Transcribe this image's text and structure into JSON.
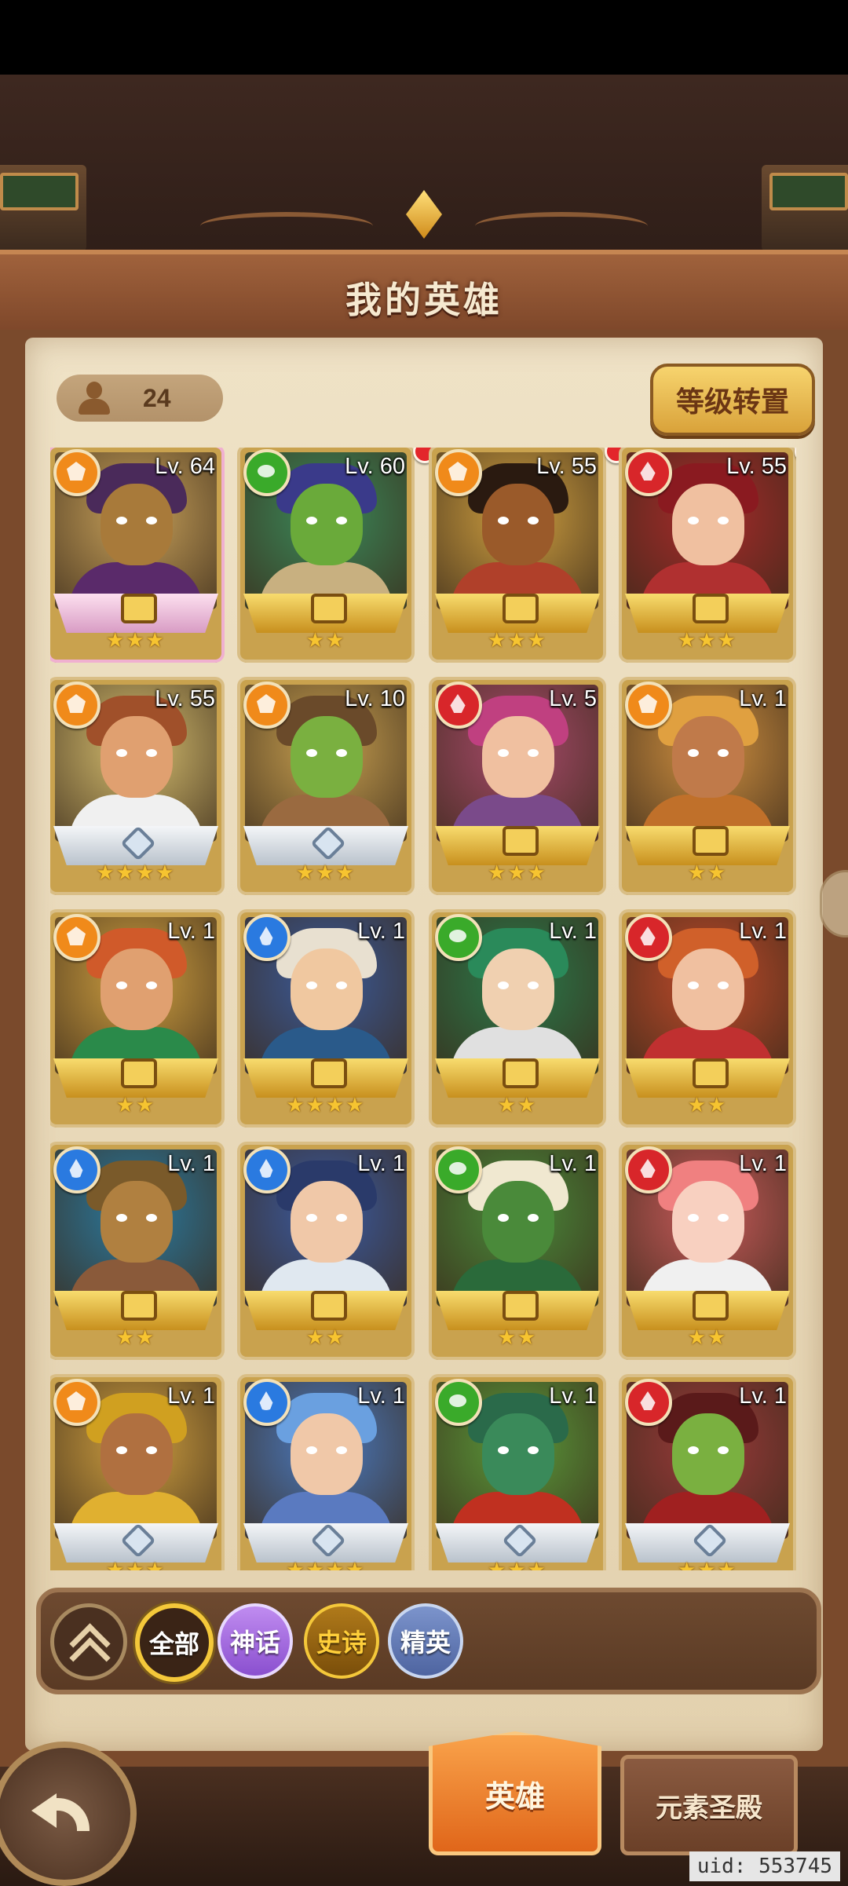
{
  "page": {
    "title": "我的英雄",
    "hero_count": "24",
    "reset_button": "等级转置",
    "uid": "uid: 553745"
  },
  "heroes": [
    {
      "level": "Lv. 64",
      "element": "light",
      "stars": "★★★",
      "banner": "pink",
      "red_dot": false,
      "skin": "#a87a3a",
      "hair": "#4a2a5a",
      "body": "#5a2a6a",
      "bg": "#c9a25a"
    },
    {
      "level": "Lv. 60",
      "element": "nature",
      "stars": "★★",
      "banner": "gold",
      "red_dot": true,
      "skin": "#6aaa3a",
      "hair": "#3a3a8a",
      "body": "#c8b080",
      "bg": "#3a8a5a"
    },
    {
      "level": "Lv. 55",
      "element": "light",
      "stars": "★★★",
      "banner": "gold",
      "red_dot": true,
      "skin": "#9a5a2a",
      "hair": "#2a1a10",
      "body": "#b0402a",
      "bg": "#d0a040"
    },
    {
      "level": "Lv. 55",
      "element": "fire",
      "stars": "★★★",
      "banner": "gold",
      "red_dot": true,
      "skin": "#f0c0a0",
      "hair": "#8a1a20",
      "body": "#b03030",
      "bg": "#a82a2a"
    },
    {
      "level": "Lv. 55",
      "element": "light",
      "stars": "★★★★",
      "banner": "white",
      "red_dot": false,
      "skin": "#e0a070",
      "hair": "#a0502a",
      "body": "#f0f0f0",
      "bg": "#d8c070"
    },
    {
      "level": "Lv. 10",
      "element": "light",
      "stars": "★★★",
      "banner": "white",
      "red_dot": false,
      "skin": "#7ab040",
      "hair": "#6a4a2a",
      "body": "#9a6a40",
      "bg": "#c8a050"
    },
    {
      "level": "Lv. 5",
      "element": "fire",
      "stars": "★★★",
      "banner": "gold",
      "red_dot": false,
      "skin": "#f0c0a0",
      "hair": "#c04080",
      "body": "#7a4a8a",
      "bg": "#a84a6a"
    },
    {
      "level": "Lv. 1",
      "element": "light",
      "stars": "★★",
      "banner": "gold",
      "red_dot": false,
      "skin": "#c07a4a",
      "hair": "#e0a040",
      "body": "#c0702a",
      "bg": "#d09040"
    },
    {
      "level": "Lv. 1",
      "element": "light",
      "stars": "★★",
      "banner": "gold",
      "red_dot": false,
      "skin": "#e0a070",
      "hair": "#d05a2a",
      "body": "#2a8a4a",
      "bg": "#d0a040"
    },
    {
      "level": "Lv. 1",
      "element": "water",
      "stars": "★★★★",
      "banner": "gold",
      "red_dot": false,
      "skin": "#f0c8a0",
      "hair": "#e8e0d0",
      "body": "#2a5a8a",
      "bg": "#3a5a9a"
    },
    {
      "level": "Lv. 1",
      "element": "nature",
      "stars": "★★",
      "banner": "gold",
      "red_dot": false,
      "skin": "#f0d0b0",
      "hair": "#2a8a5a",
      "body": "#e0e0e0",
      "bg": "#2a7a4a"
    },
    {
      "level": "Lv. 1",
      "element": "fire",
      "stars": "★★",
      "banner": "gold",
      "red_dot": false,
      "skin": "#f0c0a0",
      "hair": "#d0602a",
      "body": "#c03030",
      "bg": "#c04a2a"
    },
    {
      "level": "Lv. 1",
      "element": "water",
      "stars": "★★",
      "banner": "gold",
      "red_dot": false,
      "skin": "#b08040",
      "hair": "#7a5a2a",
      "body": "#8a5a3a",
      "bg": "#2a7aa0"
    },
    {
      "level": "Lv. 1",
      "element": "water",
      "stars": "★★",
      "banner": "gold",
      "red_dot": false,
      "skin": "#f0c8a8",
      "hair": "#2a3a6a",
      "body": "#e0e8f0",
      "bg": "#3a5aa0"
    },
    {
      "level": "Lv. 1",
      "element": "nature",
      "stars": "★★",
      "banner": "gold",
      "red_dot": false,
      "skin": "#4a8a3a",
      "hair": "#f0e8d0",
      "body": "#2a6a3a",
      "bg": "#4a8a3a"
    },
    {
      "level": "Lv. 1",
      "element": "fire",
      "stars": "★★",
      "banner": "gold",
      "red_dot": false,
      "skin": "#f8d0c0",
      "hair": "#f08080",
      "body": "#f0f0f0",
      "bg": "#c85a5a"
    },
    {
      "level": "Lv. 1",
      "element": "light",
      "stars": "★★★",
      "banner": "white",
      "red_dot": false,
      "skin": "#b07040",
      "hair": "#d0a020",
      "body": "#e0b030",
      "bg": "#d0a040"
    },
    {
      "level": "Lv. 1",
      "element": "water",
      "stars": "★★★★",
      "banner": "white",
      "red_dot": false,
      "skin": "#f0c8a8",
      "hair": "#6aa0e0",
      "body": "#5a7ac0",
      "bg": "#4a7ac0"
    },
    {
      "level": "Lv. 1",
      "element": "nature",
      "stars": "★★★",
      "banner": "white",
      "red_dot": false,
      "skin": "#3a8a5a",
      "hair": "#2a6a4a",
      "body": "#c03020",
      "bg": "#5a9a3a"
    },
    {
      "level": "Lv. 1",
      "element": "fire",
      "stars": "★★★",
      "banner": "white",
      "red_dot": false,
      "skin": "#7ab040",
      "hair": "#5a1a1a",
      "body": "#a02020",
      "bg": "#9a3a3a"
    }
  ],
  "element_colors": {
    "light": "#f08a1a",
    "nature": "#3aaa2a",
    "fire": "#d8262a",
    "water": "#2a7ae0"
  },
  "filters": {
    "all": "全部",
    "myth": "神话",
    "epic": "史诗",
    "elite": "精英"
  },
  "tabs": {
    "heroes": "英雄",
    "temple": "元素圣殿"
  }
}
